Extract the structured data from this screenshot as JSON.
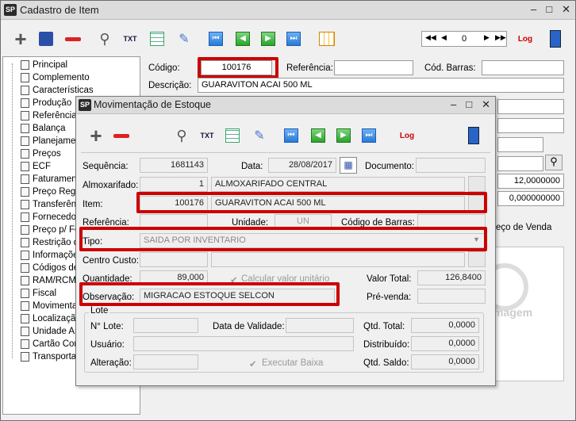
{
  "main": {
    "title": "Cadastro de Item",
    "pager_value": "0",
    "tree": [
      "Principal",
      "Complemento",
      "Características",
      "Produção",
      "Referências",
      "Balança",
      "Planejamento",
      "Preços",
      "ECF",
      "Faturamento",
      "Preço Regional",
      "Transferência",
      "Fornecedor",
      "Preço p/ Fornecedor",
      "Restrição de",
      "Informações",
      "Códigos de",
      "RAM/RCM/",
      "Fiscal",
      "Movimentação",
      "Localização",
      "Unidade Armaz.",
      "Cartão Cont.",
      "Transportadora"
    ],
    "codigo_label": "Código:",
    "codigo_value": "100176",
    "referencia_label": "Referência:",
    "codbarras_label": "Cód. Barras:",
    "descricao_label": "Descrição:",
    "descricao_value": "GUARAVITON ACAI 500 ML",
    "value1": "12,0000000",
    "value2": "0,000000000",
    "preco_venda": "eço de Venda",
    "imagem": "magem"
  },
  "sub": {
    "title": "Movimentação de Estoque",
    "sequencia_label": "Sequência:",
    "sequencia_value": "1681143",
    "data_label": "Data:",
    "data_value": "28/08/2017",
    "documento_label": "Documento:",
    "almox_label": "Almoxarifado:",
    "almox_code": "1",
    "almox_name": "ALMOXARIFADO CENTRAL",
    "item_label": "Item:",
    "item_code": "100176",
    "item_name": "GUARAVITON ACAI 500 ML",
    "referencia_label": "Referência:",
    "unidade_label": "Unidade:",
    "unidade_value": "UN",
    "codbarras_label": "Código de Barras:",
    "tipo_label": "Tipo:",
    "tipo_value": "SAIDA POR INVENTARIO",
    "centro_label": "Centro Custo:",
    "quantidade_label": "Quantidade:",
    "quantidade_value": "89,000",
    "calcular_label": "Calcular valor unitário",
    "valor_total_label": "Valor Total:",
    "valor_total_value": "126,8400",
    "observacao_label": "Observação:",
    "observacao_value": "MIGRACAO ESTOQUE SELCON",
    "prevenda_label": "Pré-venda:",
    "lote_group": "Lote",
    "nlote_label": "N° Lote:",
    "validade_label": "Data de Validade:",
    "qtd_total_label": "Qtd. Total:",
    "qtd_total_value": "0,0000",
    "usuario_label": "Usuário:",
    "distribuido_label": "Distribuído:",
    "distribuido_value": "0,0000",
    "alteracao_label": "Alteração:",
    "executar_label": "Executar Baixa",
    "qtd_saldo_label": "Qtd. Saldo:",
    "qtd_saldo_value": "0,0000"
  }
}
